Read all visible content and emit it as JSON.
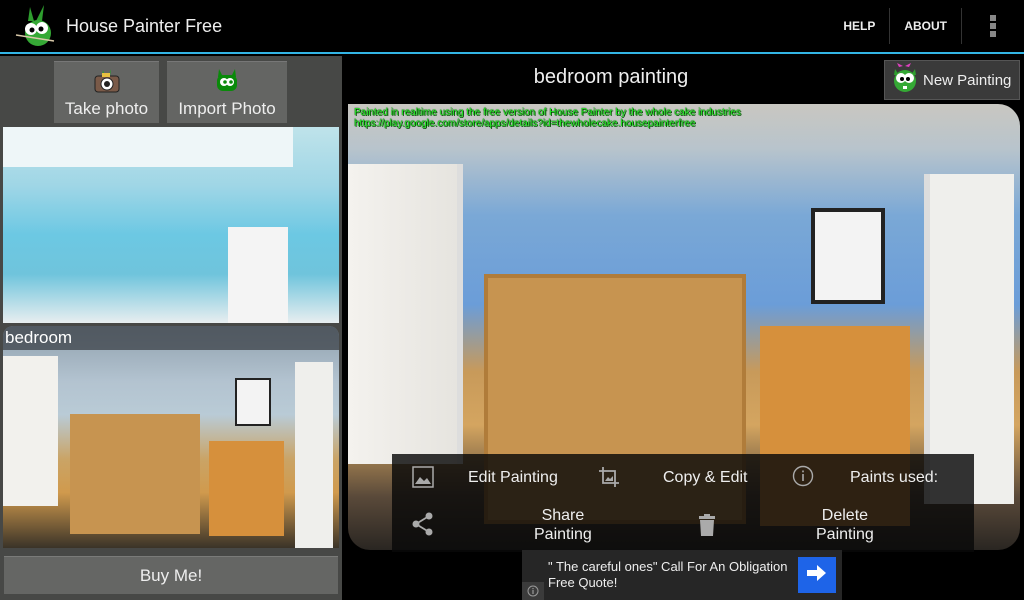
{
  "app": {
    "title": "House Painter Free",
    "logo_icon": "green-bunny-logo-icon",
    "accent_color": "#33b5e5"
  },
  "actionbar": {
    "help_label": "HELP",
    "about_label": "ABOUT",
    "overflow_icon": "overflow-menu-icon"
  },
  "left_panel": {
    "take_photo_label": "Take photo",
    "take_photo_icon": "camera-icon",
    "import_photo_label": "Import Photo",
    "import_photo_icon": "green-bunny-icon",
    "gallery": [
      {
        "label": ""
      },
      {
        "label": "bedroom"
      }
    ],
    "buy_label": "Buy Me!"
  },
  "right_panel": {
    "painting_title": "bedroom painting",
    "new_painting_label": "New Painting",
    "new_painting_icon": "bunny-with-bow-icon",
    "watermark_line1": "Painted in realtime using the free version of House Painter by the whole cake industries",
    "watermark_line2": "https://play.google.com/store/apps/details?id=thewholecake.housepainterfree",
    "menu": {
      "edit_label": "Edit Painting",
      "copy_label": "Copy & Edit",
      "paints_used_label": "Paints used:",
      "share_label_1": "Share",
      "share_label_2": "Painting",
      "delete_label_1": "Delete",
      "delete_label_2": "Painting"
    }
  },
  "ad": {
    "text_line1": "\" The careful ones\" Call For An Obligation",
    "text_line2": "Free Quote!",
    "cta_icon": "arrow-right-icon",
    "cta_color": "#1e64e8",
    "info_icon": "info-icon"
  }
}
